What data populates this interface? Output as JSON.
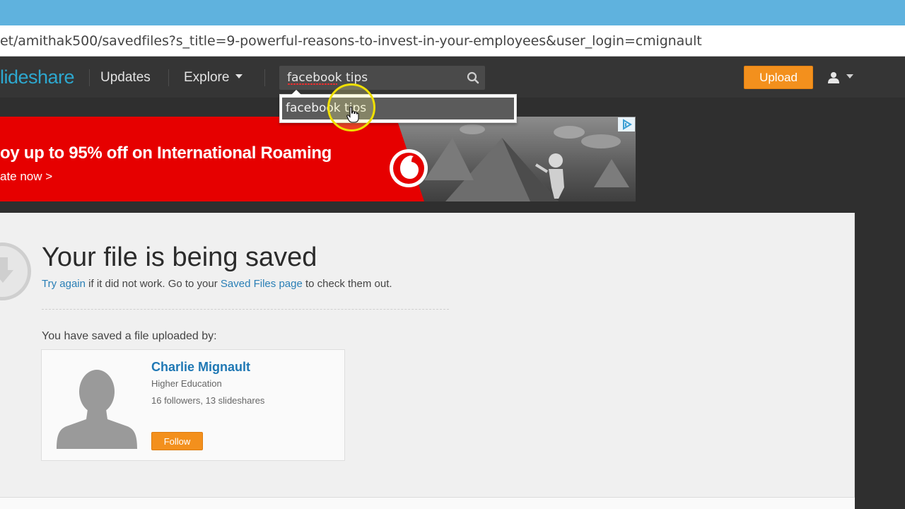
{
  "browser": {
    "url": "et/amithak500/savedfiles?s_title=9-powerful-reasons-to-invest-in-your-employees&user_login=cmignault"
  },
  "nav": {
    "logo": "lideshare",
    "updates_label": "Updates",
    "explore_label": "Explore",
    "search_value": "facebook tips",
    "upload_label": "Upload",
    "user_icon": "user-icon",
    "search_icon": "search-icon"
  },
  "suggestions": [
    {
      "label": "facebook tips"
    }
  ],
  "ad": {
    "headline": "oy up to 95% off on International Roaming",
    "cta": "ate now >"
  },
  "content": {
    "title": "Your file is being saved",
    "try_again": "Try again",
    "middle_text": " if it did not work. Go to your ",
    "saved_files_link": "Saved Files page",
    "end_text": " to check them out.",
    "saved_by": "You have saved a file uploaded by:"
  },
  "uploader": {
    "name": "Charlie Mignault",
    "category": "Higher Education",
    "stats": "16 followers, 13 slideshares",
    "follow_label": "Follow"
  },
  "colors": {
    "brand": "#2da8cf",
    "accent": "#f3901d",
    "link": "#2a7fb6",
    "ad_red": "#e60000"
  }
}
